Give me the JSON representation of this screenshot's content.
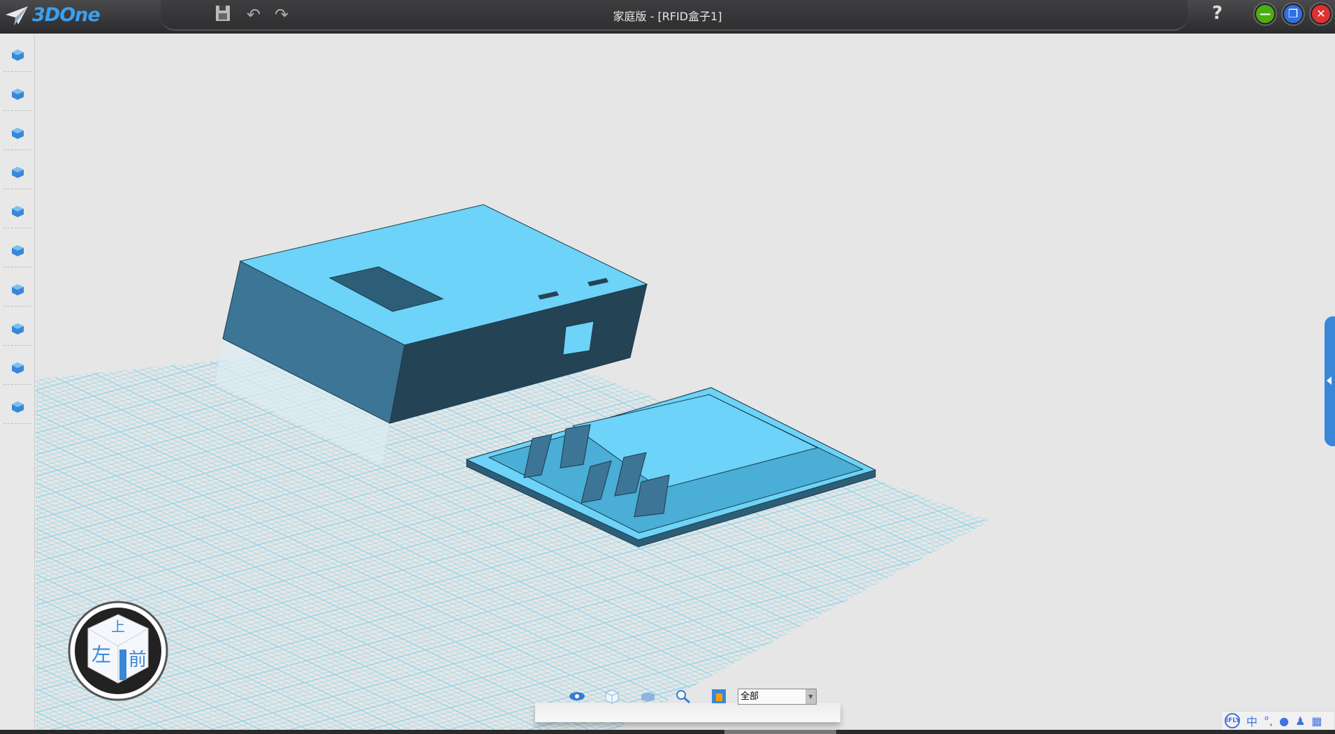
{
  "app": {
    "logo_text": "3DOne",
    "title": "家庭版 - [RFID盒子1]"
  },
  "titlebar_tools": [
    {
      "name": "save-icon",
      "glyph": "💾"
    },
    {
      "name": "undo-icon",
      "glyph": "↶"
    },
    {
      "name": "redo-icon",
      "glyph": "↷"
    }
  ],
  "window_buttons": [
    {
      "name": "minimize-button",
      "glyph": "—",
      "color": "#4caf10"
    },
    {
      "name": "restore-button",
      "glyph": "❐",
      "color": "#2f6fe0"
    },
    {
      "name": "close-button",
      "glyph": "✕",
      "color": "#e03030"
    }
  ],
  "help_label": "?",
  "left_tools": [
    "basic-solid-icon",
    "sketch-draw-icon",
    "sketch-edit-icon",
    "special-feature-icon",
    "feature-modeling-icon",
    "basic-edit-icon",
    "auto-snap-icon",
    "combine-icon",
    "distance-measure-icon",
    "material-render-icon"
  ],
  "nav_cube": {
    "top": "上",
    "left": "左",
    "front": "前"
  },
  "view_tools": [
    "view-eye-icon",
    "wireframe-view-icon",
    "shaded-view-icon",
    "zoom-fit-icon",
    "view-select-icon"
  ],
  "filter": {
    "value": "全部"
  },
  "ime": {
    "logo": "iFLY",
    "lang": "中",
    "punct": "°,",
    "mic": "🎤",
    "user": "👤",
    "apps": "▦"
  },
  "colors": {
    "model": "#6dd3f8",
    "model_dark": "#255068",
    "grid": "#8fd4ea",
    "accent": "#3a86d8"
  }
}
